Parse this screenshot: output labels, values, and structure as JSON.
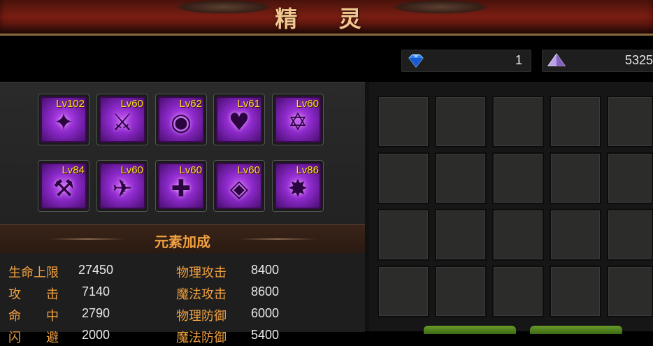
{
  "header": {
    "title": "精 灵"
  },
  "currency": {
    "diamonds": {
      "icon": "blue-diamond-icon",
      "value": "1"
    },
    "crystals": {
      "icon": "purple-crystal-icon",
      "value": "5325"
    }
  },
  "pets": [
    {
      "level": "Lv102",
      "icon": "feather-icon"
    },
    {
      "level": "Lv60",
      "icon": "winged-sword-icon"
    },
    {
      "level": "Lv62",
      "icon": "eye-icon"
    },
    {
      "level": "Lv61",
      "icon": "heart-icon"
    },
    {
      "level": "Lv60",
      "icon": "star-shield-icon"
    },
    {
      "level": "Lv84",
      "icon": "winged-axe-icon"
    },
    {
      "level": "Lv60",
      "icon": "winged-boot-icon"
    },
    {
      "level": "Lv60",
      "icon": "cross-shield-icon"
    },
    {
      "level": "Lv60",
      "icon": "winged-shield-icon"
    },
    {
      "level": "Lv86",
      "icon": "star-staff-icon"
    }
  ],
  "bonus": {
    "title": "元素加成",
    "left": [
      {
        "label": "生命上限",
        "value": "27450"
      },
      {
        "label": "攻　　击",
        "value": "7140"
      },
      {
        "label": "命　　中",
        "value": "2790"
      },
      {
        "label": "闪　　避",
        "value": "2000"
      }
    ],
    "right": [
      {
        "label": "物理攻击",
        "value": "8400"
      },
      {
        "label": "魔法攻击",
        "value": "8600"
      },
      {
        "label": "物理防御",
        "value": "6000"
      },
      {
        "label": "魔法防御",
        "value": "5400"
      }
    ]
  },
  "colors": {
    "accent": "#f0a040",
    "level": "#f8e020",
    "pet": "#a43ee0"
  }
}
